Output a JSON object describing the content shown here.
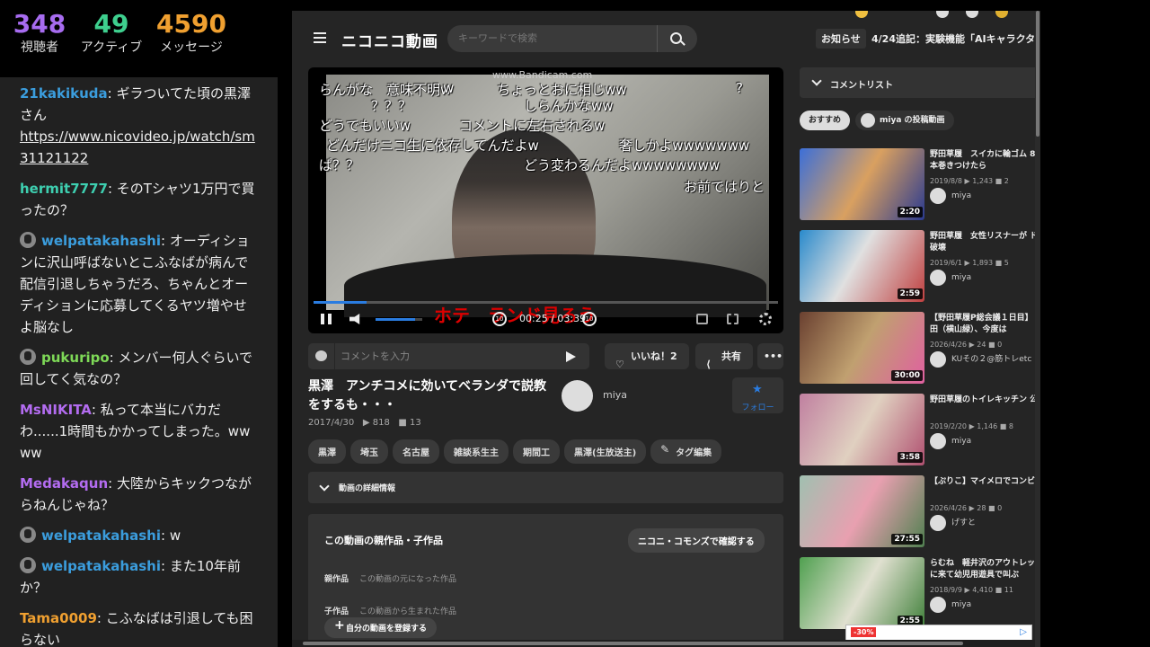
{
  "stats": {
    "viewers": "348",
    "viewers_label": "視聴者",
    "active": "49",
    "active_label": "アクティブ",
    "messages": "4590",
    "messages_label": "メッセージ",
    "colors": {
      "viewers": "#a76cf0",
      "active": "#3ecf8e",
      "messages": "#f0a030"
    }
  },
  "chat": [
    {
      "user": "21kakikuda",
      "color": "#3b9ddd",
      "avatar": false,
      "text": "ギラついてた頃の黒澤さん",
      "link": "https://www.nicovideo.jp/watch/sm31121122"
    },
    {
      "user": "hermit7777",
      "color": "#3ecfb0",
      "avatar": false,
      "text": "そのTシャツ1万円で買ったの？"
    },
    {
      "user": "welpatakahashi",
      "color": "#3b9ddd",
      "avatar": true,
      "text": "オーディションに沢山呼ばないとこふなばが病んで配信引退しちゃうだろ、ちゃんとオーディションに応募してくるヤツ増やせよ脳なし"
    },
    {
      "user": "pukuripo",
      "color": "#7ed957",
      "avatar": true,
      "text": "メンバー何人ぐらいで回してく気なの？"
    },
    {
      "user": "MsNIKITA",
      "color": "#b36cf0",
      "avatar": false,
      "text": "私って本当にバカだわ......1時間もかかってしまった。wwww"
    },
    {
      "user": "Medakaqun",
      "color": "#b36cf0",
      "avatar": false,
      "text": "大陸からキックつながらねんじゃね？"
    },
    {
      "user": "welpatakahashi",
      "color": "#3b9ddd",
      "avatar": true,
      "text": "w"
    },
    {
      "user": "welpatakahashi",
      "color": "#3b9ddd",
      "avatar": true,
      "text": "また10年前か？"
    },
    {
      "user": "Tama0009",
      "color": "#f0a030",
      "avatar": false,
      "text": "こふなばは引退しても困らない"
    }
  ],
  "header": {
    "logo": "ニコニコ動画",
    "search_placeholder": "キーワードで検索",
    "notice": "お知らせ",
    "news": "4/24追記：実験機能「AIキャラクター"
  },
  "player": {
    "watermark": "www.Bandicam.com",
    "comments": [
      "らんがな　意味不明w",
      "w",
      "ちょっとおに相じww",
      "しらんかなww",
      "？？？",
      "?",
      "どうでもいいw",
      "コメントに左右されるw",
      "どんだけニコ生に依存してんだよw",
      "奢しかよwwwwwww",
      "ぱ？？",
      "どう変わるんだよwwwwwwww",
      "お前ではりと"
    ],
    "caption": "ホテ　ランド見ろう",
    "time": "00:25 / 03:39",
    "progress": 0.114,
    "volume": 0.85,
    "skip_back": "10",
    "skip_fwd": "10"
  },
  "comment_input": {
    "placeholder": "コメントを入力"
  },
  "actions": {
    "like": "いいね！2",
    "share": "共有",
    "more": "•••"
  },
  "video": {
    "title": "黒澤　アンチコメに効いてベランダで説教をするも・・・",
    "date": "2017/4/30",
    "views": "818",
    "comments": "13",
    "owner": "miya",
    "follow": "フォロー"
  },
  "tags": [
    "黒澤",
    "埼玉",
    "名古屋",
    "雑談系生主",
    "期間工",
    "黒澤(生放送主)"
  ],
  "tag_edit": "タグ編集",
  "details_label": "動画の詳細情報",
  "family": {
    "title": "この動画の親作品・子作品",
    "commons_button": "ニコニ・コモンズで確認する",
    "parent_label": "親作品",
    "parent_value": "この動画の元になった作品",
    "child_label": "子作品",
    "child_value": "この動画から生まれた作品",
    "register": "自分の動画を登録する"
  },
  "sidebar": {
    "header": "コメントリスト",
    "chip_recommend": "おすすめ",
    "chip_owner": "miya の投稿動画",
    "items": [
      {
        "title": "野田草履　スイカに輪ゴム 800本巻きつけたら",
        "date": "2019/8/8",
        "views": "1,243",
        "comments": "2",
        "owner": "miya",
        "duration": "2:20",
        "bg": "linear-gradient(120deg,#3c6fd8,#d9a060 50%,#2a3a90)"
      },
      {
        "title": "野田草履　女性リスナーが ドア破壊",
        "date": "2019/6/1",
        "views": "1,893",
        "comments": "5",
        "owner": "miya",
        "duration": "2:59",
        "bg": "linear-gradient(120deg,#2a8acc,#e0e0e0 45%,#c04040)"
      },
      {
        "title": "【野田草履P総会議１日目】 保田（横山緑）、今度は",
        "date": "2026/4/26",
        "views": "24",
        "comments": "0",
        "owner": "KUその２@筋トレetc",
        "duration": "30:00",
        "bg": "linear-gradient(120deg,#6a4030,#c0a070 50%,#e060a0)"
      },
      {
        "title": "野田草履のトイレキッチン 公開",
        "date": "2019/2/20",
        "views": "1,146",
        "comments": "8",
        "owner": "miya",
        "duration": "3:58",
        "bg": "linear-gradient(120deg,#c080a0,#e0d0c0 50%,#b05070)"
      },
      {
        "title": "【ぷりこ】マイメロでコンビニ",
        "date": "2026/4/26",
        "views": "28",
        "comments": "0",
        "owner": "げすと",
        "duration": "27:55",
        "bg": "linear-gradient(120deg,#a0c0b0,#e8a0b0 50%,#508050)"
      },
      {
        "title": "らむね　軽井沢のアウトレット に来て幼児用遊具で叫ぶ",
        "date": "2018/9/9",
        "views": "4,410",
        "comments": "11",
        "owner": "miya",
        "duration": "2:55",
        "bg": "linear-gradient(120deg,#50a050,#e0e0d0 50%,#40803a)"
      }
    ]
  },
  "ad": {
    "badge": "-30%"
  }
}
